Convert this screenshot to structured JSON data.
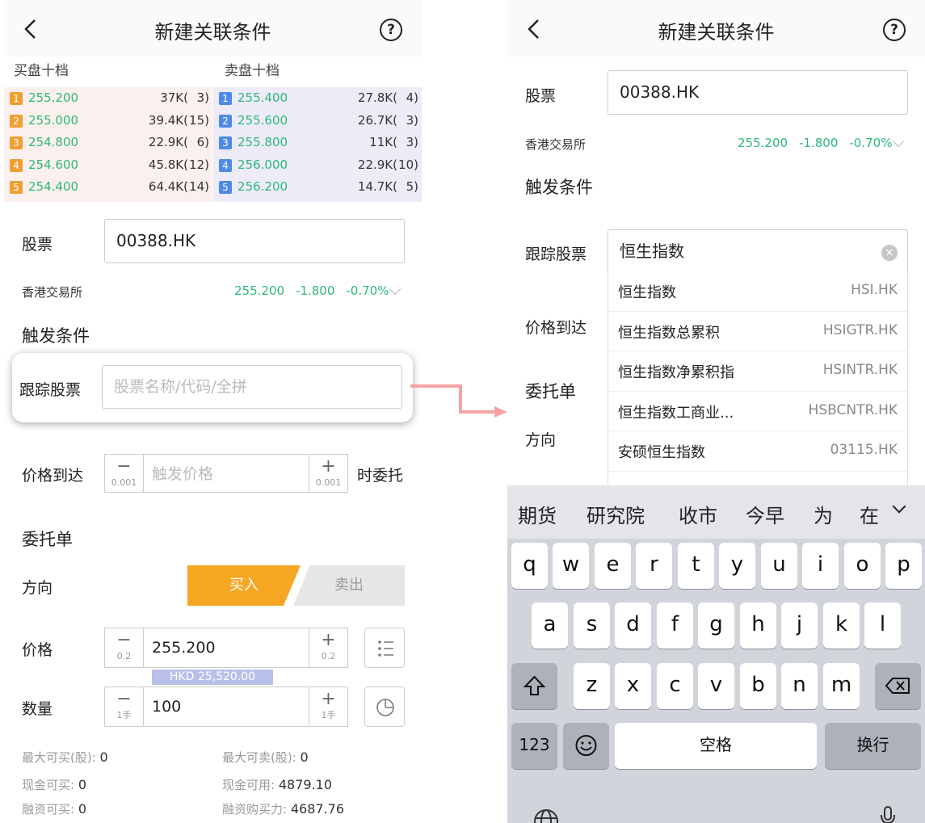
{
  "left": {
    "nav": {
      "title": "新建关联条件",
      "help": "?"
    },
    "orderbook": {
      "buy_title": "买盘十档",
      "sell_title": "卖盘十档",
      "buy": [
        {
          "level": "1",
          "price": "255.200",
          "volume": "37K(",
          "count": "3)"
        },
        {
          "level": "2",
          "price": "255.000",
          "volume": "39.4K(",
          "count": "15)"
        },
        {
          "level": "3",
          "price": "254.800",
          "volume": "22.9K(",
          "count": "6)"
        },
        {
          "level": "4",
          "price": "254.600",
          "volume": "45.8K(",
          "count": "12)"
        },
        {
          "level": "5",
          "price": "254.400",
          "volume": "64.4K(",
          "count": "14)"
        }
      ],
      "sell": [
        {
          "level": "1",
          "price": "255.400",
          "volume": "27.8K(",
          "count": "4)"
        },
        {
          "level": "2",
          "price": "255.600",
          "volume": "26.7K(",
          "count": "3)"
        },
        {
          "level": "3",
          "price": "255.800",
          "volume": "11K(",
          "count": "3)"
        },
        {
          "level": "4",
          "price": "256.000",
          "volume": "22.9K(",
          "count": "10)"
        },
        {
          "level": "5",
          "price": "256.200",
          "volume": "14.7K(",
          "count": "5)"
        }
      ]
    },
    "stock": {
      "label": "股票",
      "value": "00388.HK",
      "exchange": "香港交易所",
      "price": "255.200",
      "change": "-1.800",
      "change_pct": "-0.70%"
    },
    "trigger": {
      "title": "触发条件",
      "track_label": "跟踪股票",
      "track_placeholder": "股票名称/代码/全拼"
    },
    "price_reach": {
      "label": "价格到达",
      "minus": "−",
      "plus": "+",
      "step": "0.001",
      "placeholder": "触发价格",
      "suffix": "时委托"
    },
    "order": {
      "title": "委托单",
      "direction_label": "方向",
      "buy": "买入",
      "sell": "卖出",
      "price_label": "价格",
      "price_value": "255.200",
      "price_step": "0.2",
      "amount_note": "HKD 25,520.00",
      "qty_label": "数量",
      "qty_value": "100",
      "qty_step": "1手"
    },
    "info": {
      "max_buy_label": "最大可买(股):",
      "max_buy": "0",
      "max_sell_label": "最大可卖(股):",
      "max_sell": "0",
      "cash_buy_label": "现金可买:",
      "cash_buy": "0",
      "cash_avail_label": "现金可用:",
      "cash_avail": "4879.10",
      "margin_buy_label": "融资可买:",
      "margin_buy": "0",
      "margin_power_label": "融资购买力:",
      "margin_power": "4687.76"
    }
  },
  "right": {
    "nav": {
      "title": "新建关联条件",
      "help": "?"
    },
    "stock": {
      "label": "股票",
      "value": "00388.HK",
      "exchange": "香港交易所",
      "price": "255.200",
      "change": "-1.800",
      "change_pct": "-0.70%"
    },
    "trigger": {
      "title": "触发条件",
      "track_label": "跟踪股票",
      "track_value": "恒生指数"
    },
    "price_reach_label": "价格到达",
    "order_title": "委托单",
    "direction_label": "方向",
    "suggestions": [
      {
        "name": "恒生指数",
        "code": "HSI.HK"
      },
      {
        "name": "恒生指数总累积",
        "code": "HSIGTR.HK"
      },
      {
        "name": "恒生指数净累积指",
        "code": "HSINTR.HK"
      },
      {
        "name": "恒生指数工商业...",
        "code": "HSBCNTR.HK"
      },
      {
        "name": "安硕恒生指数",
        "code": "03115.HK"
      }
    ],
    "keyboard": {
      "candidates": [
        "期货",
        "研究院",
        "收市",
        "今早",
        "为",
        "在"
      ],
      "row1": [
        "q",
        "w",
        "e",
        "r",
        "t",
        "y",
        "u",
        "i",
        "o",
        "p"
      ],
      "row2": [
        "a",
        "s",
        "d",
        "f",
        "g",
        "h",
        "j",
        "k",
        "l"
      ],
      "row3": [
        "z",
        "x",
        "c",
        "v",
        "b",
        "n",
        "m"
      ],
      "num_key": "123",
      "space_key": "空格",
      "return_key": "换行"
    }
  },
  "colors": {
    "up_green": "#2eb87a",
    "buy_orange": "#f5a623",
    "buy_level": "#f0a032",
    "sell_level": "#4f8ae8",
    "arrow": "#f4a3a3"
  }
}
